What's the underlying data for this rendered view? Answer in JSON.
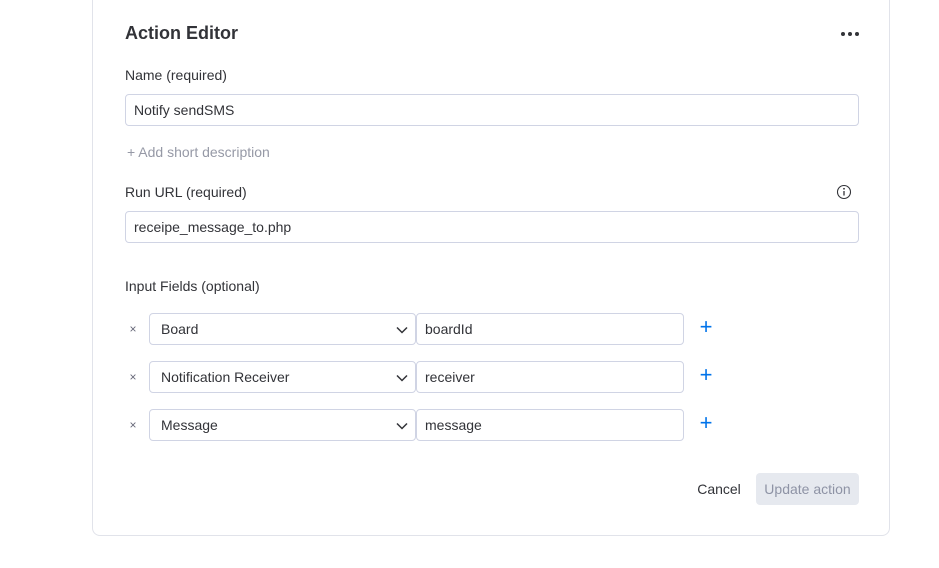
{
  "editor": {
    "title": "Action Editor",
    "more_icon": "more-horizontal-icon",
    "name_label": "Name (required)",
    "name_value": "Notify sendSMS",
    "add_description": "+ Add short description",
    "run_url_label": "Run URL (required)",
    "run_url_value": "receipe_message_to.php",
    "info_icon": "info-icon",
    "input_fields_label": "Input Fields (optional)"
  },
  "fields": [
    {
      "remove": "×",
      "select": "Board",
      "value": "boardId",
      "add": "+"
    },
    {
      "remove": "×",
      "select": "Notification Receiver",
      "value": "receiver",
      "add": "+"
    },
    {
      "remove": "×",
      "select": "Message",
      "value": "message",
      "add": "+"
    }
  ],
  "actions": {
    "cancel_label": "Cancel",
    "update_label": "Update action"
  },
  "colors": {
    "accent": "#0073ea",
    "border": "#d0d4e4",
    "text": "#323338",
    "muted": "#9699a6",
    "disabled_bg": "#e6e9ef"
  }
}
